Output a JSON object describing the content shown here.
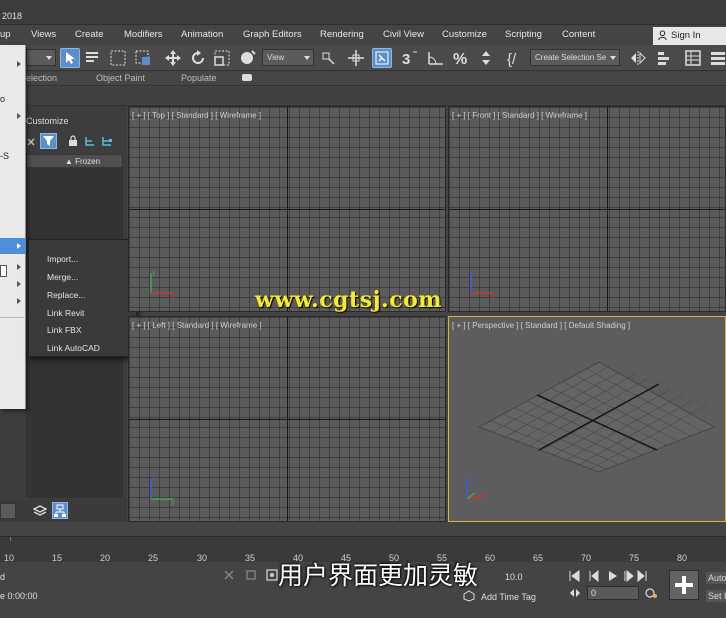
{
  "window": {
    "title": "2018"
  },
  "menubar": {
    "items": [
      "up",
      "Views",
      "Create",
      "Modifiers",
      "Animation",
      "Graph Editors",
      "Rendering",
      "Civil View",
      "Customize",
      "Scripting",
      "Content"
    ],
    "sign_in": "Sign In"
  },
  "toolbar": {
    "view_dropdown": "View",
    "selection_set": "Create Selection Se"
  },
  "ribbon": {
    "tabs": [
      "election",
      "Object Paint",
      "Populate"
    ]
  },
  "scene_explorer": {
    "menu_label": "Customize",
    "column_header": "▲ Frozen"
  },
  "file_menu": {
    "items": [
      "o",
      "-S"
    ]
  },
  "import_submenu": {
    "items": [
      "Import...",
      "Merge...",
      "Replace...",
      "Link Revit",
      "Link FBX",
      "Link AutoCAD"
    ]
  },
  "viewports": {
    "top": "[ + ] [ Top ] [ Standard ] [ Wireframe ]",
    "front": "[ + ] [ Front ] [ Standard ] [ Wireframe ]",
    "left": "[ + ] [ Left ] [ Standard ] [ Wireframe ]",
    "perspective": "[ + ] [ Perspective ] [ Standard ] [ Default Shading ]"
  },
  "watermark": "www.cgtsj.com",
  "timeline": {
    "ticks": [
      "10",
      "15",
      "20",
      "25",
      "30",
      "35",
      "40",
      "45",
      "50",
      "55",
      "60",
      "65",
      "70",
      "75",
      "80"
    ]
  },
  "status": {
    "left_label": "d",
    "time": "e 0:00:00",
    "subtitle": "用户界面更加灵敏",
    "value": "10.0",
    "add_time_tag": "Add Time Tag",
    "frame": "0",
    "auto": "Auto",
    "set": "Set K"
  },
  "colors": {
    "accent": "#5b8fc9",
    "viewport_bg": "#5b5b5b",
    "active_border": "#d9b437",
    "watermark": "#f5ea2b"
  }
}
